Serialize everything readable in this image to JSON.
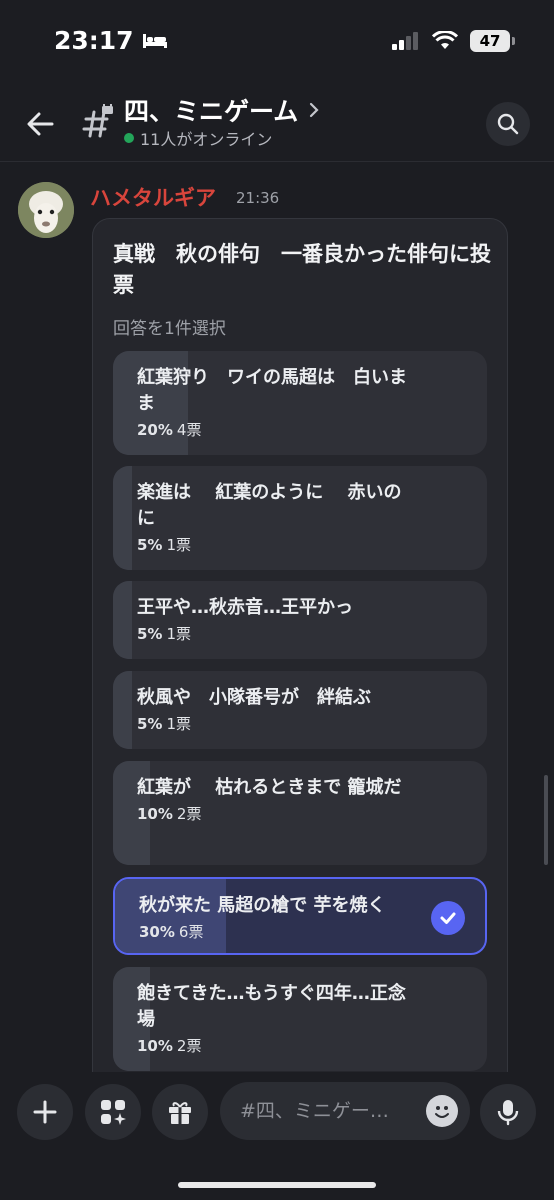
{
  "status": {
    "time": "23:17",
    "battery": "47"
  },
  "channel": {
    "name": "四、ミニゲーム",
    "online": "11人がオンライン"
  },
  "message": {
    "author": "ハメタルギア",
    "time": "21:36",
    "author_color": "#d8453c"
  },
  "poll": {
    "question": "真戦　秋の俳句　一番良かった俳句に投票",
    "hint": "回答を1件選択",
    "options": [
      {
        "text": "紅葉狩り　ワイの馬超は　白いまま",
        "percent": "20%",
        "votes": "4票",
        "share": 0.2
      },
      {
        "text": "楽進は　 紅葉のように　 赤いのに",
        "percent": "5%",
        "votes": "1票",
        "share": 0.05
      },
      {
        "text": "王平や…秋赤音…王平かっ",
        "percent": "5%",
        "votes": "1票",
        "share": 0.05
      },
      {
        "text": "秋風や　小隊番号が　絆結ぶ",
        "percent": "5%",
        "votes": "1票",
        "share": 0.05
      },
      {
        "text": "紅葉が　 枯れるときまで 籠城だ",
        "percent": "10%",
        "votes": "2票",
        "share": 0.1
      },
      {
        "text": "秋が来た 馬超の槍で 芋を焼く",
        "percent": "30%",
        "votes": "6票",
        "share": 0.3,
        "selected": true
      },
      {
        "text": "飽きてきた…もうすぐ四年…正念場",
        "percent": "10%",
        "votes": "2票",
        "share": 0.1
      }
    ]
  },
  "composer": {
    "placeholder": "#四、ミニゲー…"
  },
  "colors": {
    "accent": "#5865f2",
    "online": "#23a55a",
    "background": "#1c1d22"
  }
}
